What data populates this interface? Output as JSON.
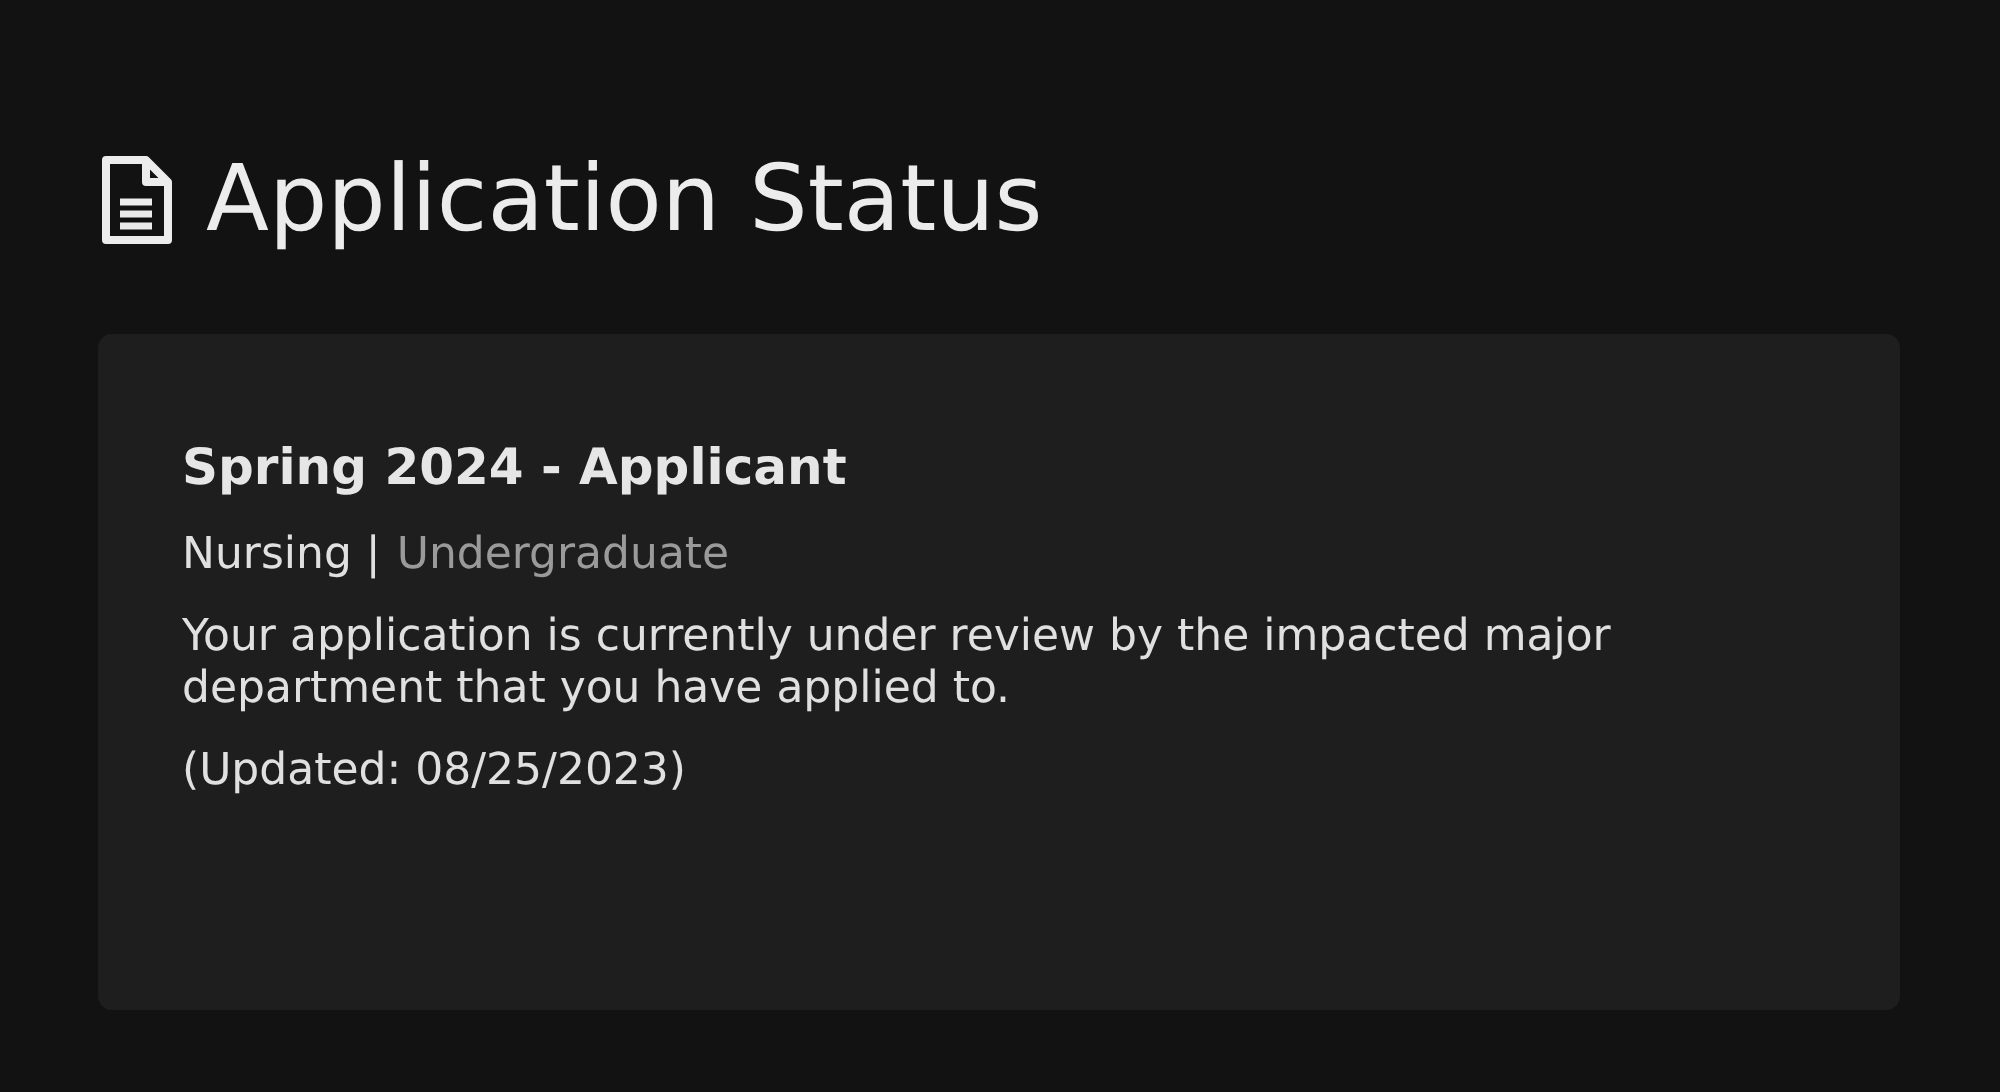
{
  "page": {
    "title": "Application Status"
  },
  "status_card": {
    "term": "Spring 2024 - Applicant",
    "program": "Nursing |",
    "level": "Undergraduate",
    "message": "Your application is currently under review by the impacted major department that you have applied to.",
    "updated": "(Updated: 08/25/2023)"
  }
}
